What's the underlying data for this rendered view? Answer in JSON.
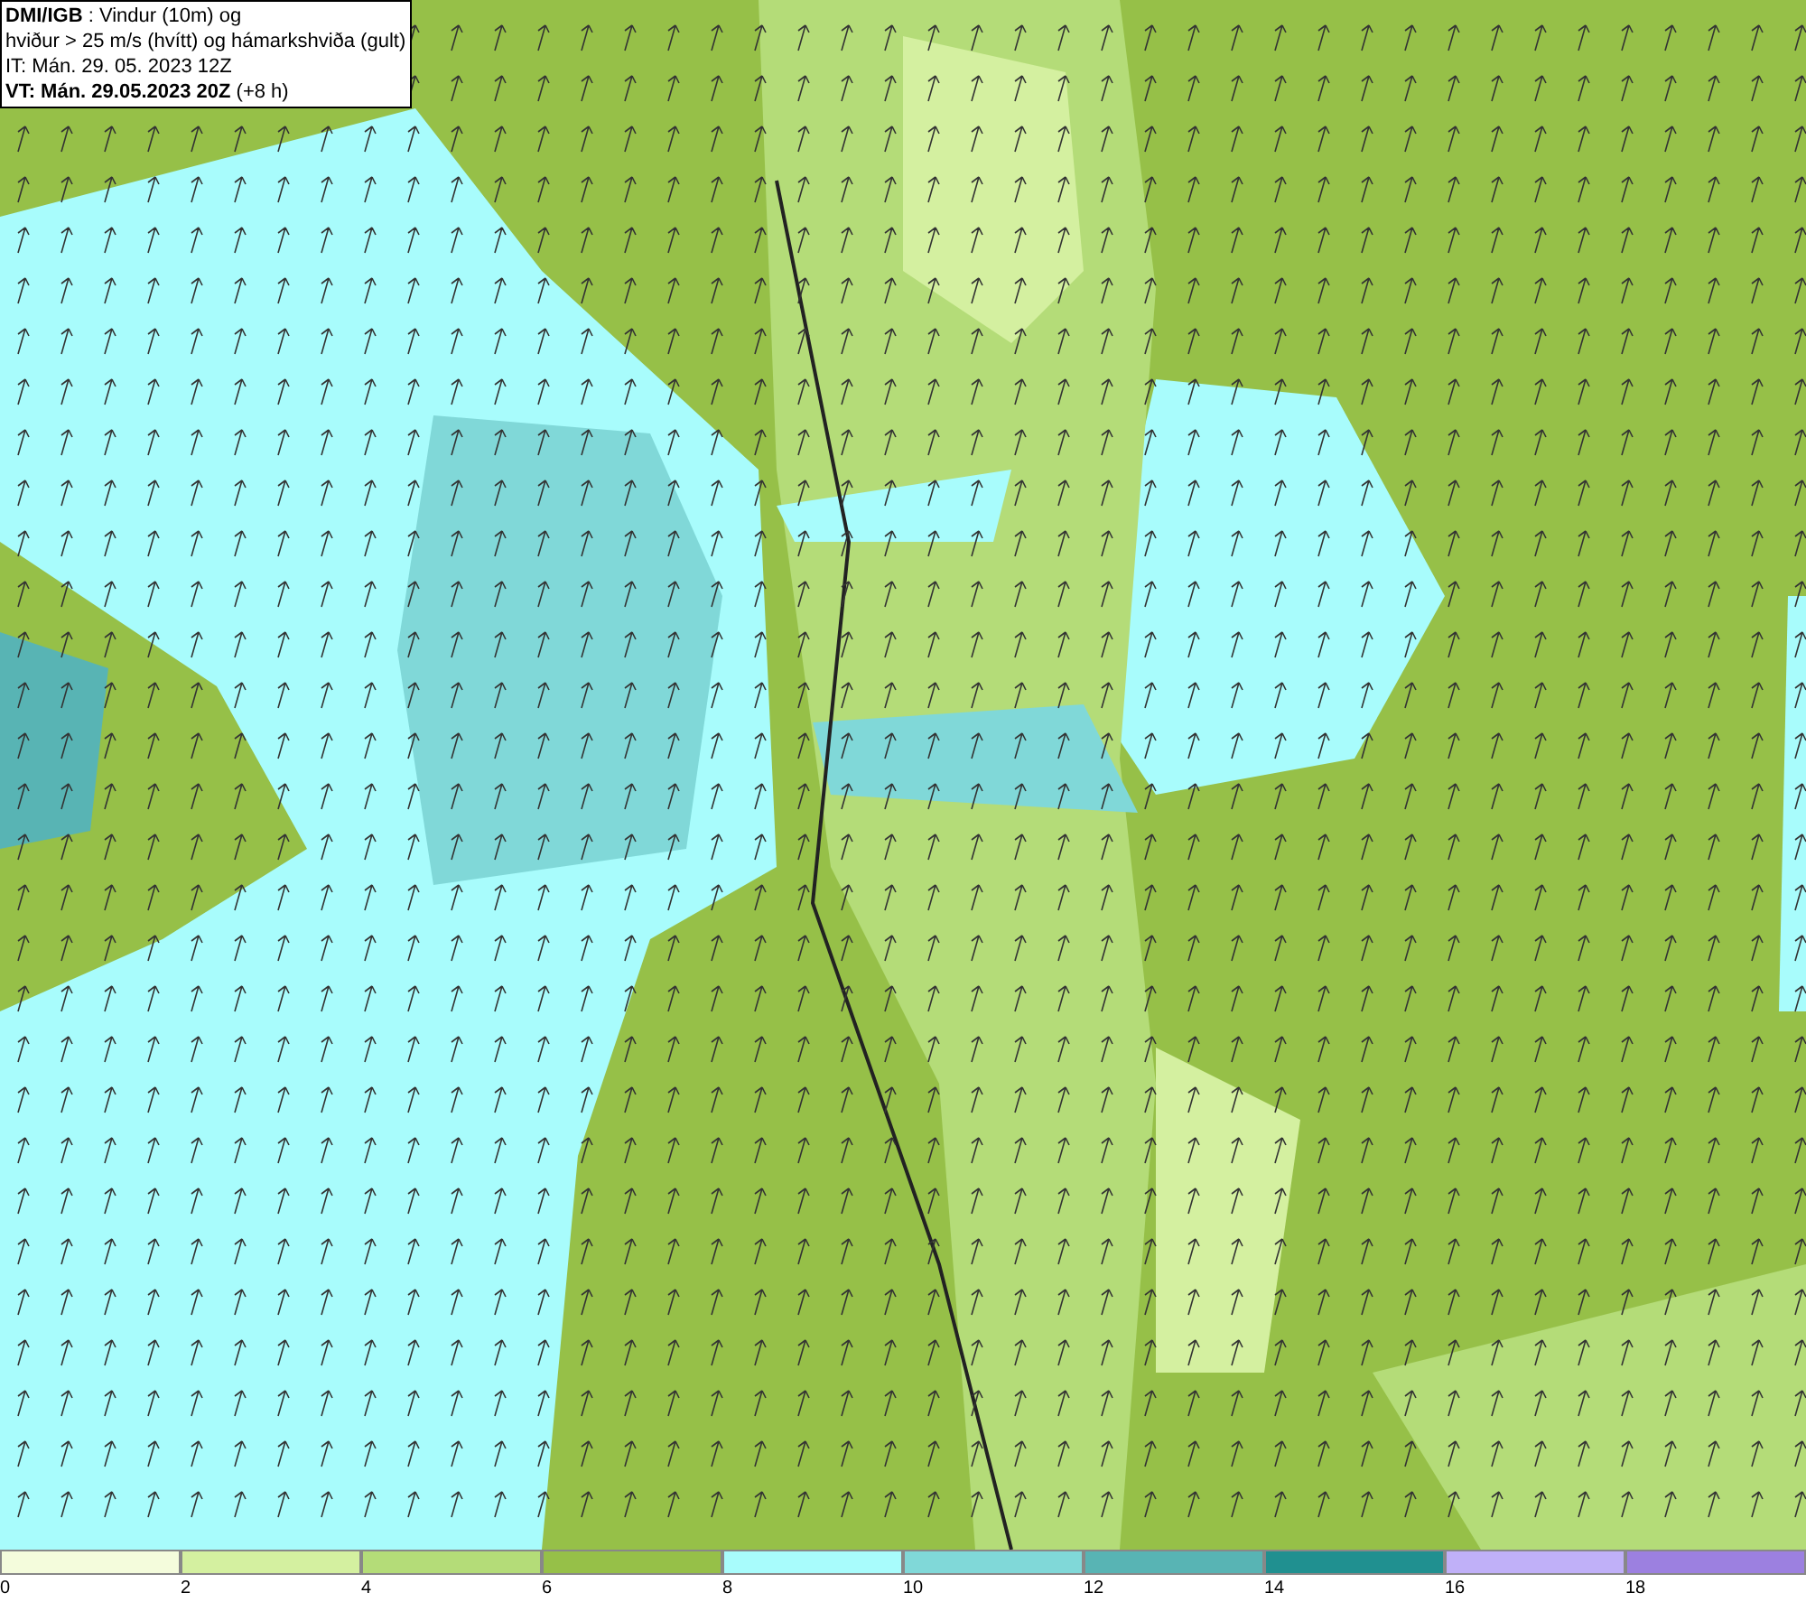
{
  "header": {
    "lines": [
      "**DMI/IGB** : Vindur (10m) og",
      "hviður > 25 m/s (hvítt) og hámarkshviða (gult)",
      "IT: Mán. 29. 05. 2023 12Z",
      "**VT: Mán. 29.05.2023 20Z** (+8 h)"
    ]
  },
  "legend": {
    "bins": [
      {
        "label": "0",
        "color": "#f4fcdc"
      },
      {
        "label": "2",
        "color": "#d4f0a0"
      },
      {
        "label": "4",
        "color": "#b4dc78"
      },
      {
        "label": "6",
        "color": "#96c048"
      },
      {
        "label": "8",
        "color": "#a8fcfc"
      },
      {
        "label": "10",
        "color": "#80d8d8"
      },
      {
        "label": "12",
        "color": "#58b4b4"
      },
      {
        "label": "14",
        "color": "#209090"
      },
      {
        "label": "16",
        "color": "#c0b0f8"
      },
      {
        "label": "18",
        "color": "#9c80e0"
      }
    ]
  }
}
